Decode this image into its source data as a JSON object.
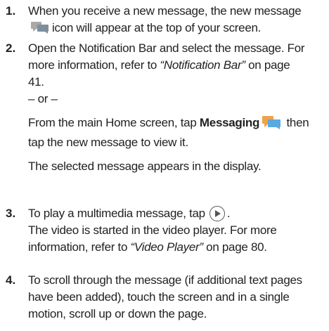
{
  "steps": [
    {
      "number": "1.",
      "line1": "When you receive a new message, the new message",
      "line2_after_icon": "icon will appear at the top of your screen."
    },
    {
      "number": "2.",
      "line1": "Open the Notification Bar and select the message. For",
      "line2_pre": "more information, refer to ",
      "link": "“Notification Bar”",
      "line2_post": " on page",
      "line3": "41.",
      "or": "– or –",
      "home_pre": "From the main Home screen, tap ",
      "home_bold": "Messaging",
      "home_post": " then",
      "home_line2": "tap the new message to view it.",
      "result": "The selected message appears in the display."
    },
    {
      "number": "3.",
      "line1": "To play a multimedia message, tap",
      "line1_end": ".",
      "line2": "The video is started in the video player. For more",
      "line3_pre": "information, refer to ",
      "link": "“Video Player”",
      "line3_post": " on page 80."
    },
    {
      "number": "4.",
      "line1": "To scroll through the message (if additional text pages",
      "line2": "have been added), touch the screen and in a single",
      "line3": "motion, scroll up or down the page."
    }
  ],
  "icons": {
    "new_message": "new-message-icon",
    "messaging": "messaging-icon",
    "play": "play-icon"
  },
  "colors": {
    "text": "#222222",
    "message_bubble_back": "#f0a24a",
    "message_bubble_front": "#5aa9e0",
    "notification_bubble": "#a8a8a8"
  }
}
